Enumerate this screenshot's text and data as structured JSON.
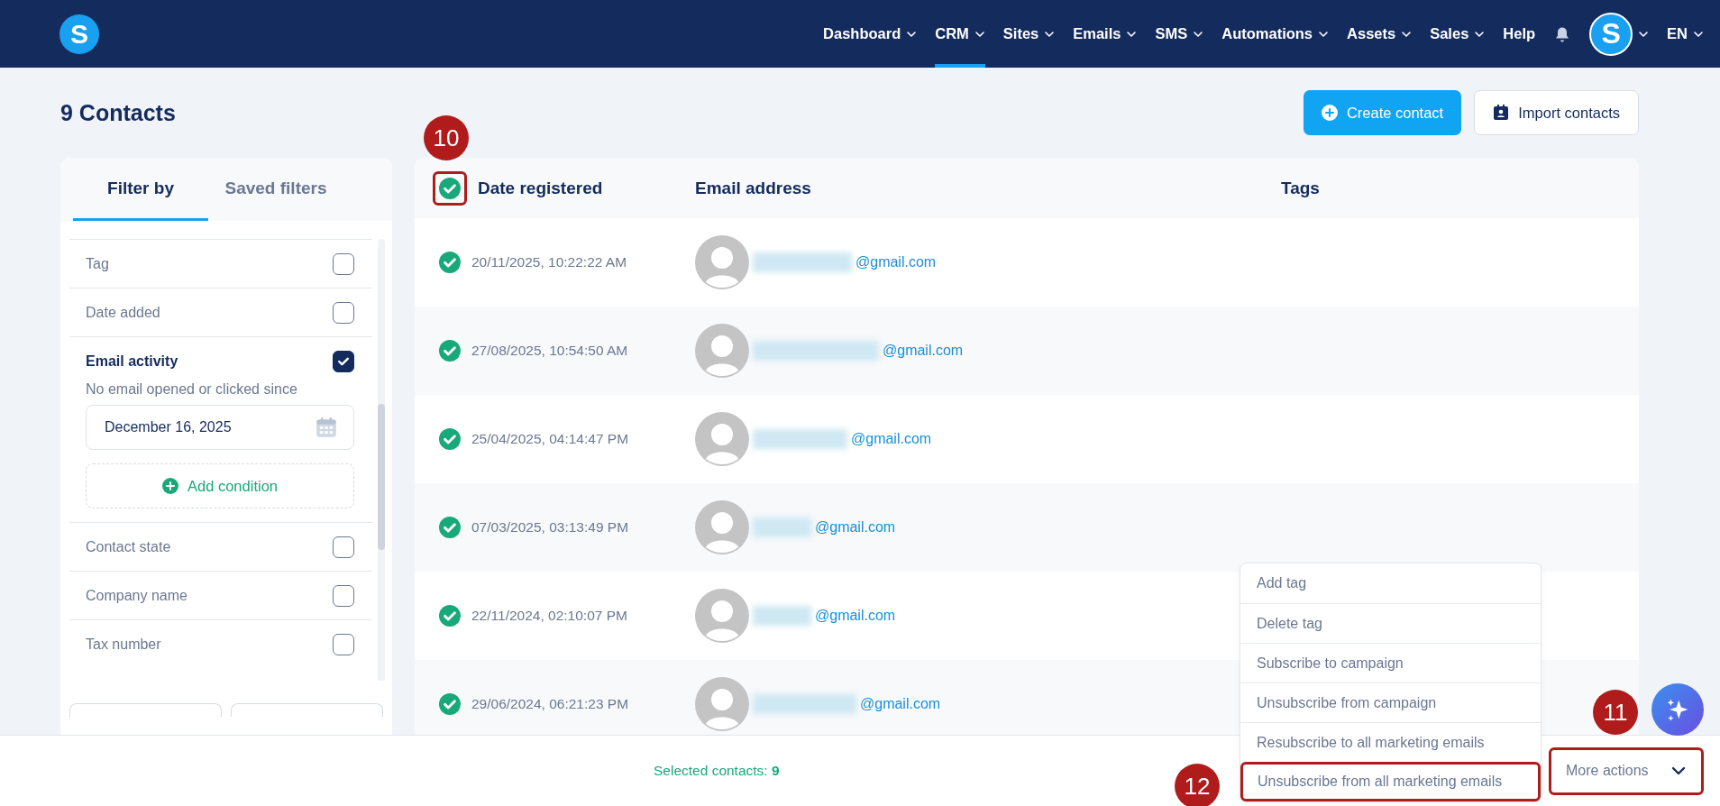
{
  "nav": {
    "logo": "S",
    "items": [
      {
        "label": "Dashboard",
        "dropdown": true,
        "selected": false
      },
      {
        "label": "CRM",
        "dropdown": true,
        "selected": true
      },
      {
        "label": "Sites",
        "dropdown": true,
        "selected": false
      },
      {
        "label": "Emails",
        "dropdown": true,
        "selected": false
      },
      {
        "label": "SMS",
        "dropdown": true,
        "selected": false
      },
      {
        "label": "Automations",
        "dropdown": true,
        "selected": false
      },
      {
        "label": "Assets",
        "dropdown": true,
        "selected": false
      },
      {
        "label": "Sales",
        "dropdown": true,
        "selected": false
      },
      {
        "label": "Help",
        "dropdown": false,
        "selected": false
      }
    ],
    "avatar": "S",
    "language": "EN"
  },
  "page": {
    "title": "9 Contacts",
    "buttons": [
      {
        "label": "Create contact",
        "kind": "primary"
      },
      {
        "label": "Import contacts",
        "kind": "secondary"
      }
    ]
  },
  "filters": {
    "tabs": [
      {
        "label": "Filter by",
        "selected": true
      },
      {
        "label": "Saved filters",
        "selected": false
      }
    ],
    "items": [
      {
        "label": "Tag",
        "checked": false
      },
      {
        "label": "Date added",
        "checked": false
      },
      {
        "label": "Email activity",
        "checked": true,
        "condition_label": "No email opened or clicked since",
        "date": "December 16, 2025",
        "add_label": "Add condition"
      },
      {
        "label": "Contact state",
        "checked": false
      },
      {
        "label": "Company name",
        "checked": false
      },
      {
        "label": "Tax number",
        "checked": false
      }
    ]
  },
  "table": {
    "all_selected": true,
    "header_callout": "10",
    "columns": [
      "Date registered",
      "Email address",
      "Tags"
    ],
    "rows": [
      {
        "selected": true,
        "date": "20/11/2025, 10:22:22 AM",
        "email": "@gmail.com"
      },
      {
        "selected": true,
        "date": "27/08/2025, 10:54:50 AM",
        "email": "@gmail.com"
      },
      {
        "selected": true,
        "date": "25/04/2025, 04:14:47 PM",
        "email": "@gmail.com"
      },
      {
        "selected": true,
        "date": "07/03/2025, 03:13:49 PM",
        "email": "@gmail.com"
      },
      {
        "selected": true,
        "date": "22/11/2024, 02:10:07 PM",
        "email": "@gmail.com"
      },
      {
        "selected": true,
        "date": "29/06/2024, 06:21:23 PM",
        "email": "@gmail.com"
      }
    ]
  },
  "menu": {
    "items": [
      {
        "label": "Add tag"
      },
      {
        "label": "Delete tag"
      },
      {
        "label": "Subscribe to campaign"
      },
      {
        "label": "Unsubscribe from campaign"
      },
      {
        "label": "Resubscribe to all marketing emails"
      },
      {
        "label": "Unsubscribe from all marketing emails",
        "callout": "12"
      }
    ]
  },
  "footer": {
    "selected_label": "Selected contacts:",
    "selected_count": "9",
    "more_actions": "More actions",
    "more_callout": "11"
  }
}
